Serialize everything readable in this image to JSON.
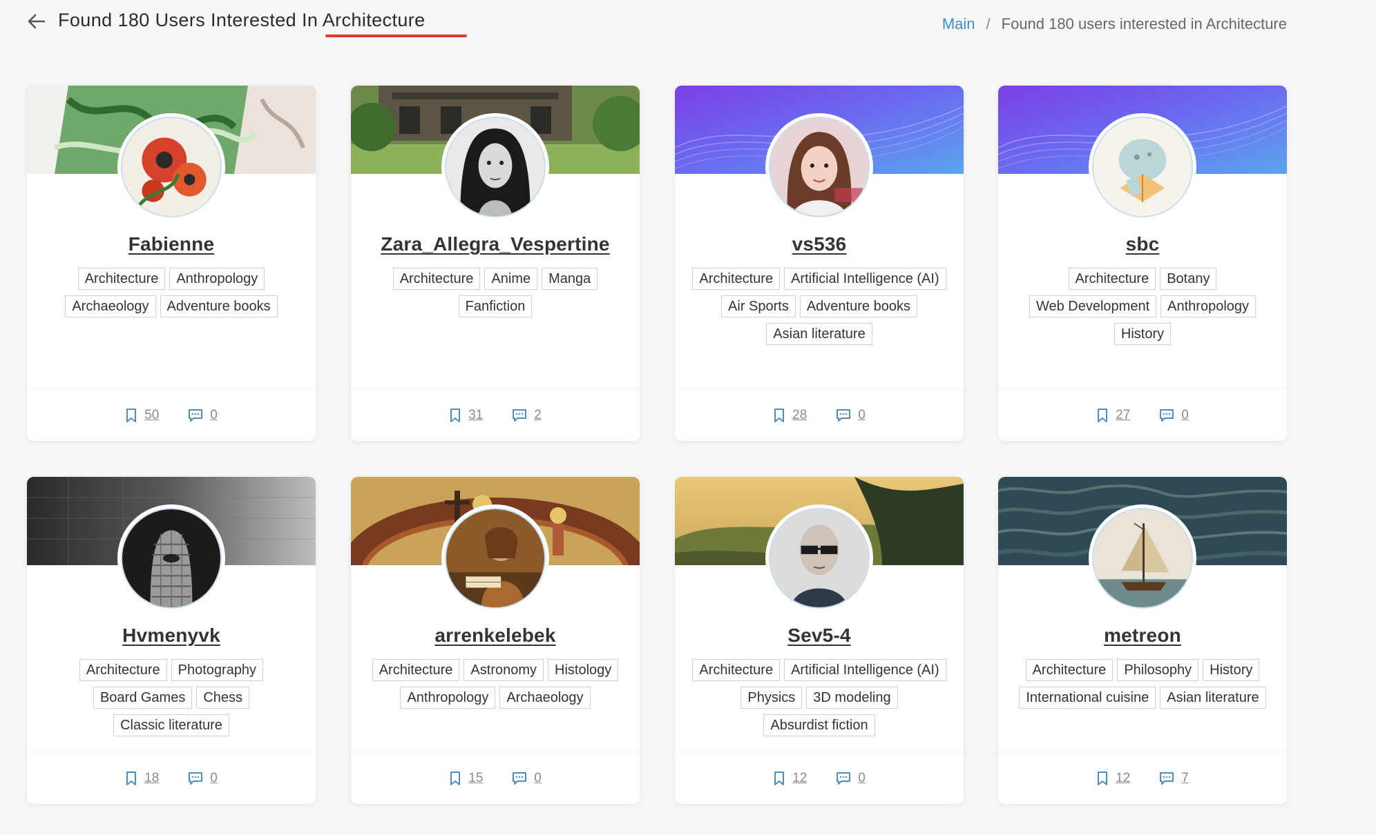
{
  "header": {
    "title": "Found 180 Users Interested In Architecture",
    "breadcrumb": {
      "home": "Main",
      "separator": "/",
      "current": "Found 180 users interested in Architecture"
    }
  },
  "colors": {
    "accent_underline": "#e03a2f",
    "link_blue": "#3a8fc9",
    "icon_blue": "#4f8cbf"
  },
  "icons": {
    "back": "arrow-left-icon",
    "bookmarks": "bookmark-icon",
    "comments": "message-icon"
  },
  "users": [
    {
      "name": "Fabienne",
      "tags": [
        "Architecture",
        "Anthropology",
        "Archaeology",
        "Adventure books"
      ],
      "bookmarks": "50",
      "comments": "0"
    },
    {
      "name": "Zara_Allegra_Vespertine",
      "tags": [
        "Architecture",
        "Anime",
        "Manga",
        "Fanfiction"
      ],
      "bookmarks": "31",
      "comments": "2"
    },
    {
      "name": "vs536",
      "tags": [
        "Architecture",
        "Artificial Intelligence (AI)",
        "Air Sports",
        "Adventure books",
        "Asian literature"
      ],
      "bookmarks": "28",
      "comments": "0"
    },
    {
      "name": "sbc",
      "tags": [
        "Architecture",
        "Botany",
        "Web Development",
        "Anthropology",
        "History"
      ],
      "bookmarks": "27",
      "comments": "0"
    },
    {
      "name": "Hvmenyvk",
      "tags": [
        "Architecture",
        "Photography",
        "Board Games",
        "Chess",
        "Classic literature"
      ],
      "bookmarks": "18",
      "comments": "0"
    },
    {
      "name": "arrenkelebek",
      "tags": [
        "Architecture",
        "Astronomy",
        "Histology",
        "Anthropology",
        "Archaeology"
      ],
      "bookmarks": "15",
      "comments": "0"
    },
    {
      "name": "Sev5-4",
      "tags": [
        "Architecture",
        "Artificial Intelligence (AI)",
        "Physics",
        "3D modeling",
        "Absurdist fiction"
      ],
      "bookmarks": "12",
      "comments": "0"
    },
    {
      "name": "metreon",
      "tags": [
        "Architecture",
        "Philosophy",
        "History",
        "International cuisine",
        "Asian literature"
      ],
      "bookmarks": "12",
      "comments": "7"
    }
  ]
}
